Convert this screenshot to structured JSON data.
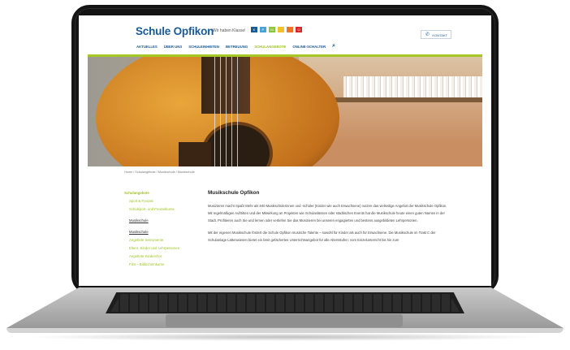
{
  "site": {
    "logo": "Schule Opfikon",
    "tagline": "Wir haben Klasse!",
    "color_blocks": [
      {
        "color": "#1b5a94",
        "letter": "K"
      },
      {
        "color": "#4aa3d6",
        "letter": "P"
      },
      {
        "color": "#8cc63f",
        "letter": "M"
      },
      {
        "color": "#f2c12e",
        "letter": ""
      },
      {
        "color": "#e8772e",
        "letter": ""
      },
      {
        "color": "#d7262f",
        "letter": "O"
      }
    ],
    "contact_label": "KONTAKT",
    "nav": [
      "AKTUELLES",
      "ÜBER UNS",
      "SCHULEINHEITEN",
      "BETREUUNG",
      "SCHULANGEBOTE",
      "ONLINE-SCHALTER"
    ],
    "nav_active": "SCHULANGEBOTE",
    "accent": "#a6c824",
    "brand": "#1b5a94"
  },
  "breadcrumb": "Home / Schulangebote / Musikschule / Musikschule",
  "sidebar": {
    "heading": "Schulangebote",
    "items": [
      "Sport & Freizeit",
      "Schulsport- und Freizeitkurse",
      "Musikschule",
      "Musikschule",
      "Angebote Instrumente",
      "Eltern, Kinder und Lehrpersonen",
      "Angebote Kinderchor",
      "Film – Bildschirmkurse"
    ]
  },
  "main": {
    "title": "Musikschule Opfikon",
    "p1": "Musizieren macht Spaß! Mehr als 840 Musikschülerinnen und -schüler (Kinder wie auch Erwachsene) nutzen das vielseitige Angebot der Musikschule Opfikon. Mit regelmäßigen Auftritten und der Mitwirkung an Projekten wie Schulanlässen oder städtischen Events hat die Musikschule heute einen guten Namen in der Stadt. Profitieren auch Sie und lernen oder vertiefen Sie das Musizieren bei unseren engagierten und bestens ausgebildeten Lehrpersonen.",
    "p2": "Mit der eigenen Musikschule fördert die Schule Opfikon musische Talente – sowohl für Kinder als auch für Erwachsene. Die Musikschule im Trakt C der Schulanlage Lättenwiesen bietet ein breit gefächertes Unterrichtsangebot für alle Altersstufen: vom Einzelunterricht bis hin zum"
  }
}
